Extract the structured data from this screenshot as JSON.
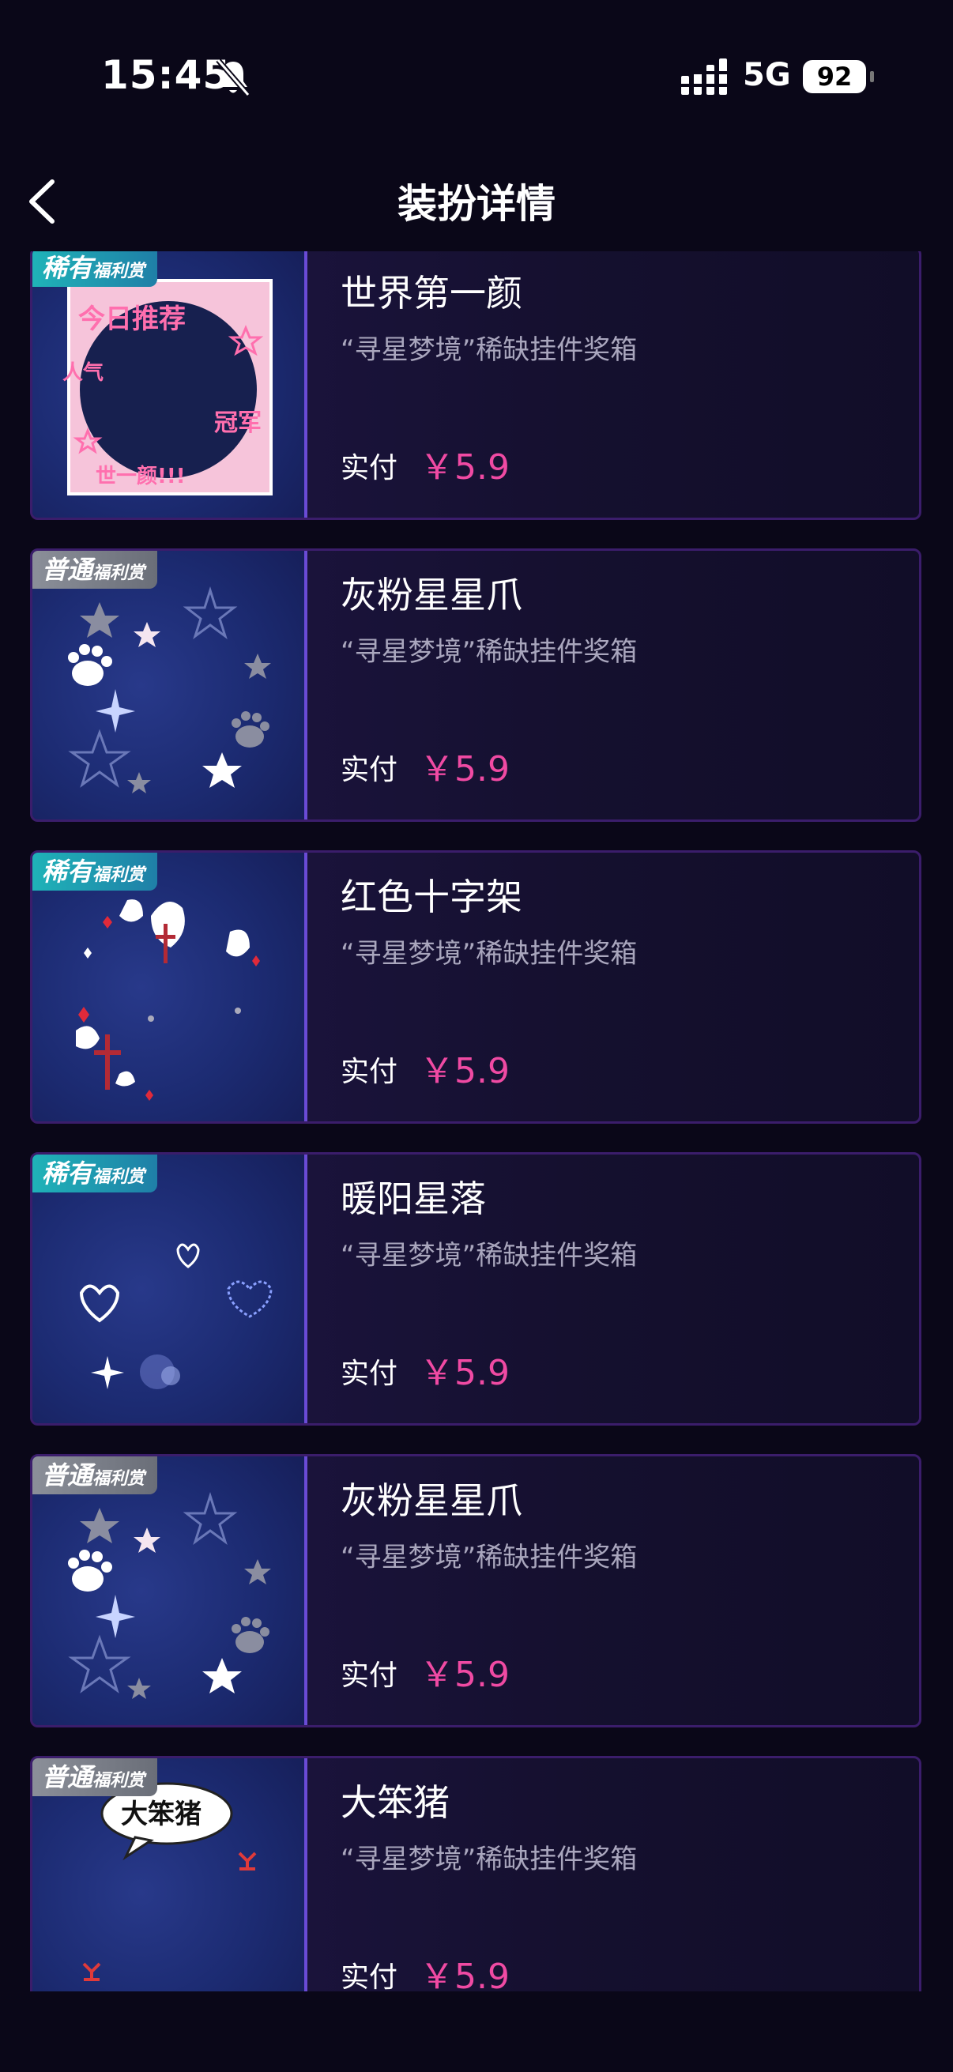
{
  "status_bar": {
    "time": "15:45",
    "network": "5G",
    "battery": "92"
  },
  "header": {
    "title": "装扮详情"
  },
  "items": [
    {
      "tag_main": "稀有",
      "tag_sub": "福利赏",
      "tag_type": "rare",
      "name": "世界第一颜",
      "desc": "“寻星梦境”稀缺挂件奖箱",
      "paid_label": "实付",
      "price": "￥5.9"
    },
    {
      "tag_main": "普通",
      "tag_sub": "福利赏",
      "tag_type": "normal",
      "name": "灰粉星星爪",
      "desc": "“寻星梦境”稀缺挂件奖箱",
      "paid_label": "实付",
      "price": "￥5.9"
    },
    {
      "tag_main": "稀有",
      "tag_sub": "福利赏",
      "tag_type": "rare",
      "name": "红色十字架",
      "desc": "“寻星梦境”稀缺挂件奖箱",
      "paid_label": "实付",
      "price": "￥5.9"
    },
    {
      "tag_main": "稀有",
      "tag_sub": "福利赏",
      "tag_type": "rare",
      "name": "暖阳星落",
      "desc": "“寻星梦境”稀缺挂件奖箱",
      "paid_label": "实付",
      "price": "￥5.9"
    },
    {
      "tag_main": "普通",
      "tag_sub": "福利赏",
      "tag_type": "normal",
      "name": "灰粉星星爪",
      "desc": "“寻星梦境”稀缺挂件奖箱",
      "paid_label": "实付",
      "price": "￥5.9"
    },
    {
      "tag_main": "普通",
      "tag_sub": "福利赏",
      "tag_type": "normal",
      "name": "大笨猪",
      "desc": "“寻星梦境”稀缺挂件奖箱",
      "paid_label": "实付",
      "price": "￥5.9"
    }
  ],
  "thumb_texts": {
    "world_face": [
      "今日推荐",
      "人气",
      "冠军",
      "世一颜!!!"
    ],
    "big_pig": "大笨猪"
  },
  "icons": {
    "back": "chevron-left-icon",
    "silent": "bell-slash-icon",
    "signal": "signal-bars-icon"
  },
  "colors": {
    "price": "#f04aa3",
    "rare_tag": "#1fb3b8",
    "normal_tag": "#8b8f99",
    "accent_border": "#6a4bd6"
  }
}
